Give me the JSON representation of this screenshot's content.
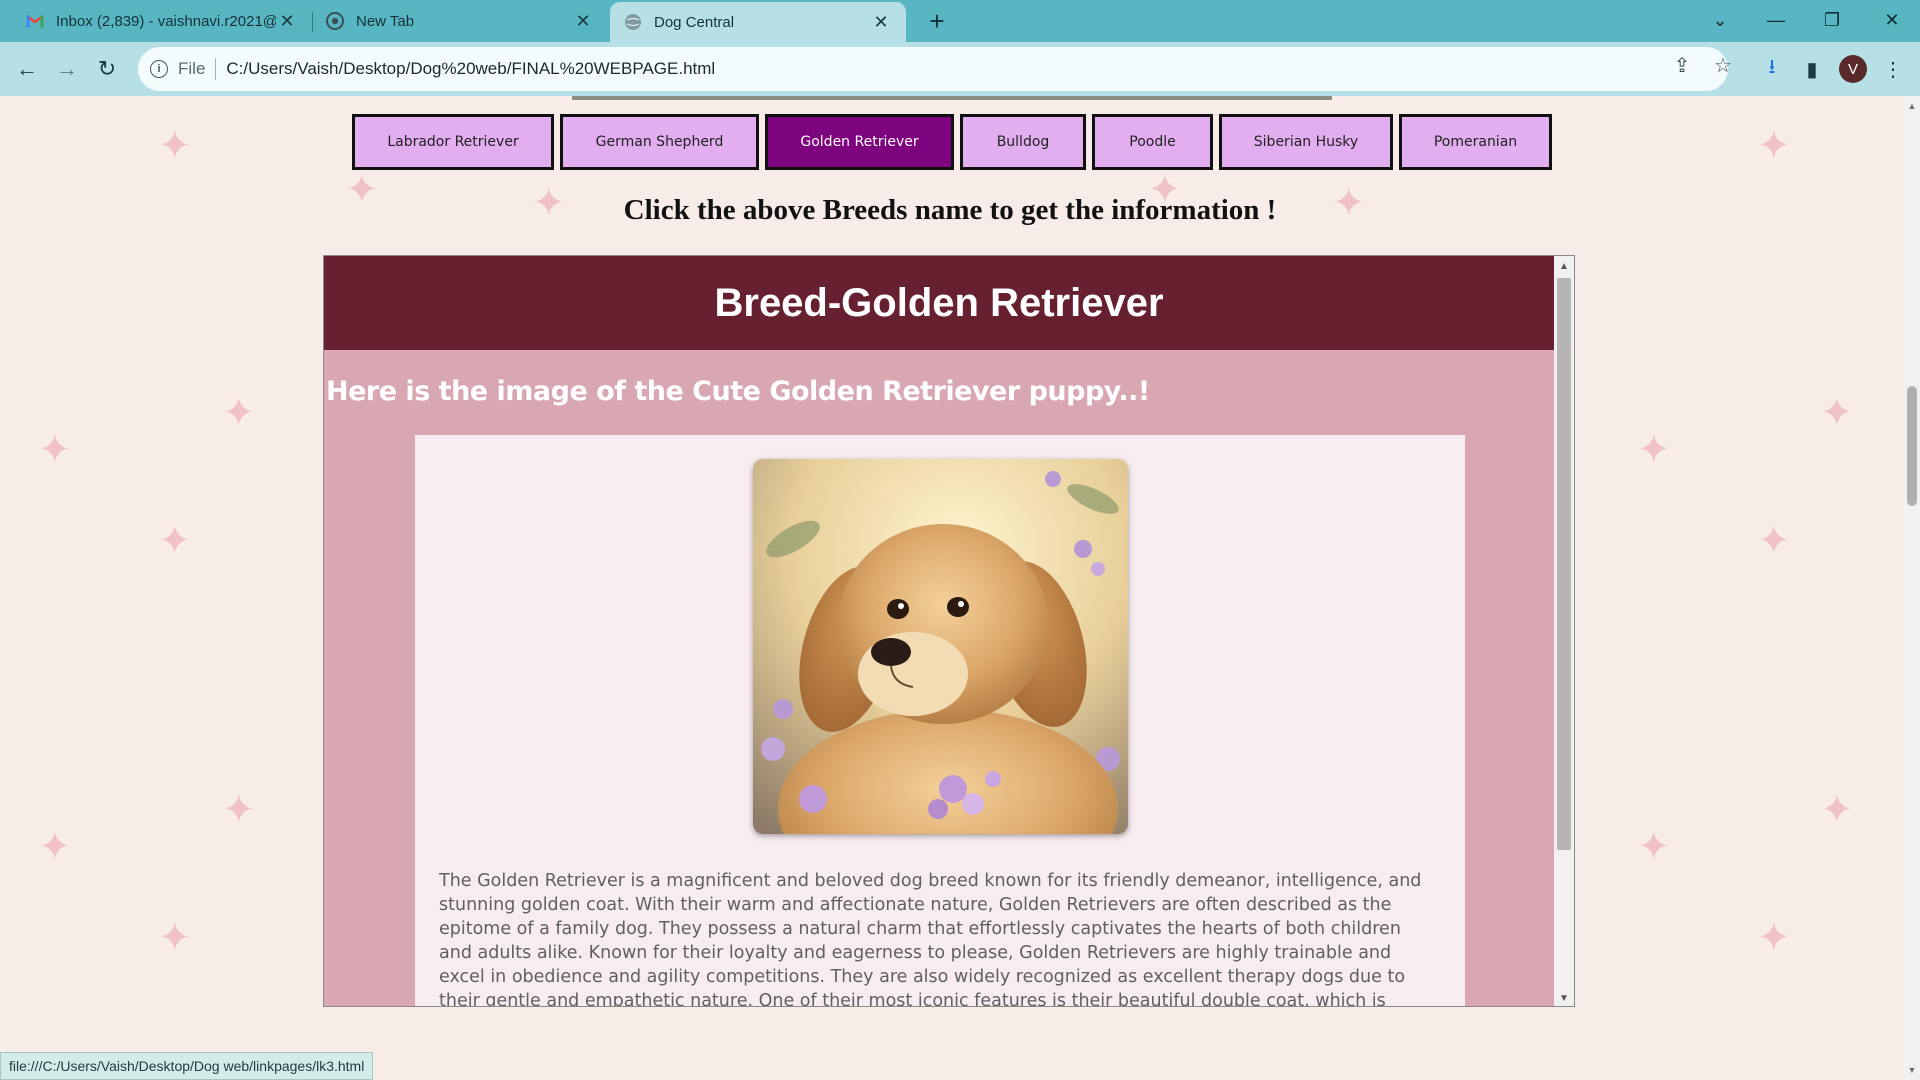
{
  "browser": {
    "tabs": [
      {
        "title": "Inbox (2,839) - vaishnavi.r2021@",
        "icon": "gmail-icon"
      },
      {
        "title": "New Tab",
        "icon": "chrome-icon"
      },
      {
        "title": "Dog Central",
        "icon": "globe-icon"
      }
    ],
    "active_tab": 2,
    "address": {
      "scheme": "File",
      "url": "C:/Users/Vaish/Desktop/Dog%20web/FINAL%20WEBPAGE.html"
    },
    "profile_initial": "V",
    "status_url": "file:///C:/Users/Vaish/Desktop/Dog web/linkpages/lk3.html"
  },
  "page": {
    "breeds": [
      {
        "label": "Labrador Retriever"
      },
      {
        "label": "German Shepherd"
      },
      {
        "label": "Golden Retriever"
      },
      {
        "label": "Bulldog"
      },
      {
        "label": "Poodle"
      },
      {
        "label": "Siberian Husky"
      },
      {
        "label": "Pomeranian"
      }
    ],
    "active_breed": 2,
    "hint": "Click the above Breeds name to get the information !",
    "detail": {
      "title": "Breed-Golden Retriever",
      "subtitle": "Here is the image of the Cute Golden Retriever puppy..!",
      "description": "The Golden Retriever is a magnificent and beloved dog breed known for its friendly demeanor, intelligence, and stunning golden coat. With their warm and affectionate nature, Golden Retrievers are often described as the epitome of a family dog. They possess a natural charm that effortlessly captivates the hearts of both children and adults alike. Known for their loyalty and eagerness to please, Golden Retrievers are highly trainable and excel in obedience and agility competitions. They are also widely recognized as excellent therapy dogs due to their gentle and empathetic nature. One of their most iconic features is their beautiful double coat, which is dense and water-"
    }
  },
  "colors": {
    "tabbar": "#58b6c3",
    "toolbar": "#b7e0e6",
    "breed_button": "#e2aef0",
    "breed_button_active": "#7d037f",
    "detail_header": "#66202f",
    "detail_background": "#d8a7b1",
    "sparkle": "#f0c1c6"
  }
}
